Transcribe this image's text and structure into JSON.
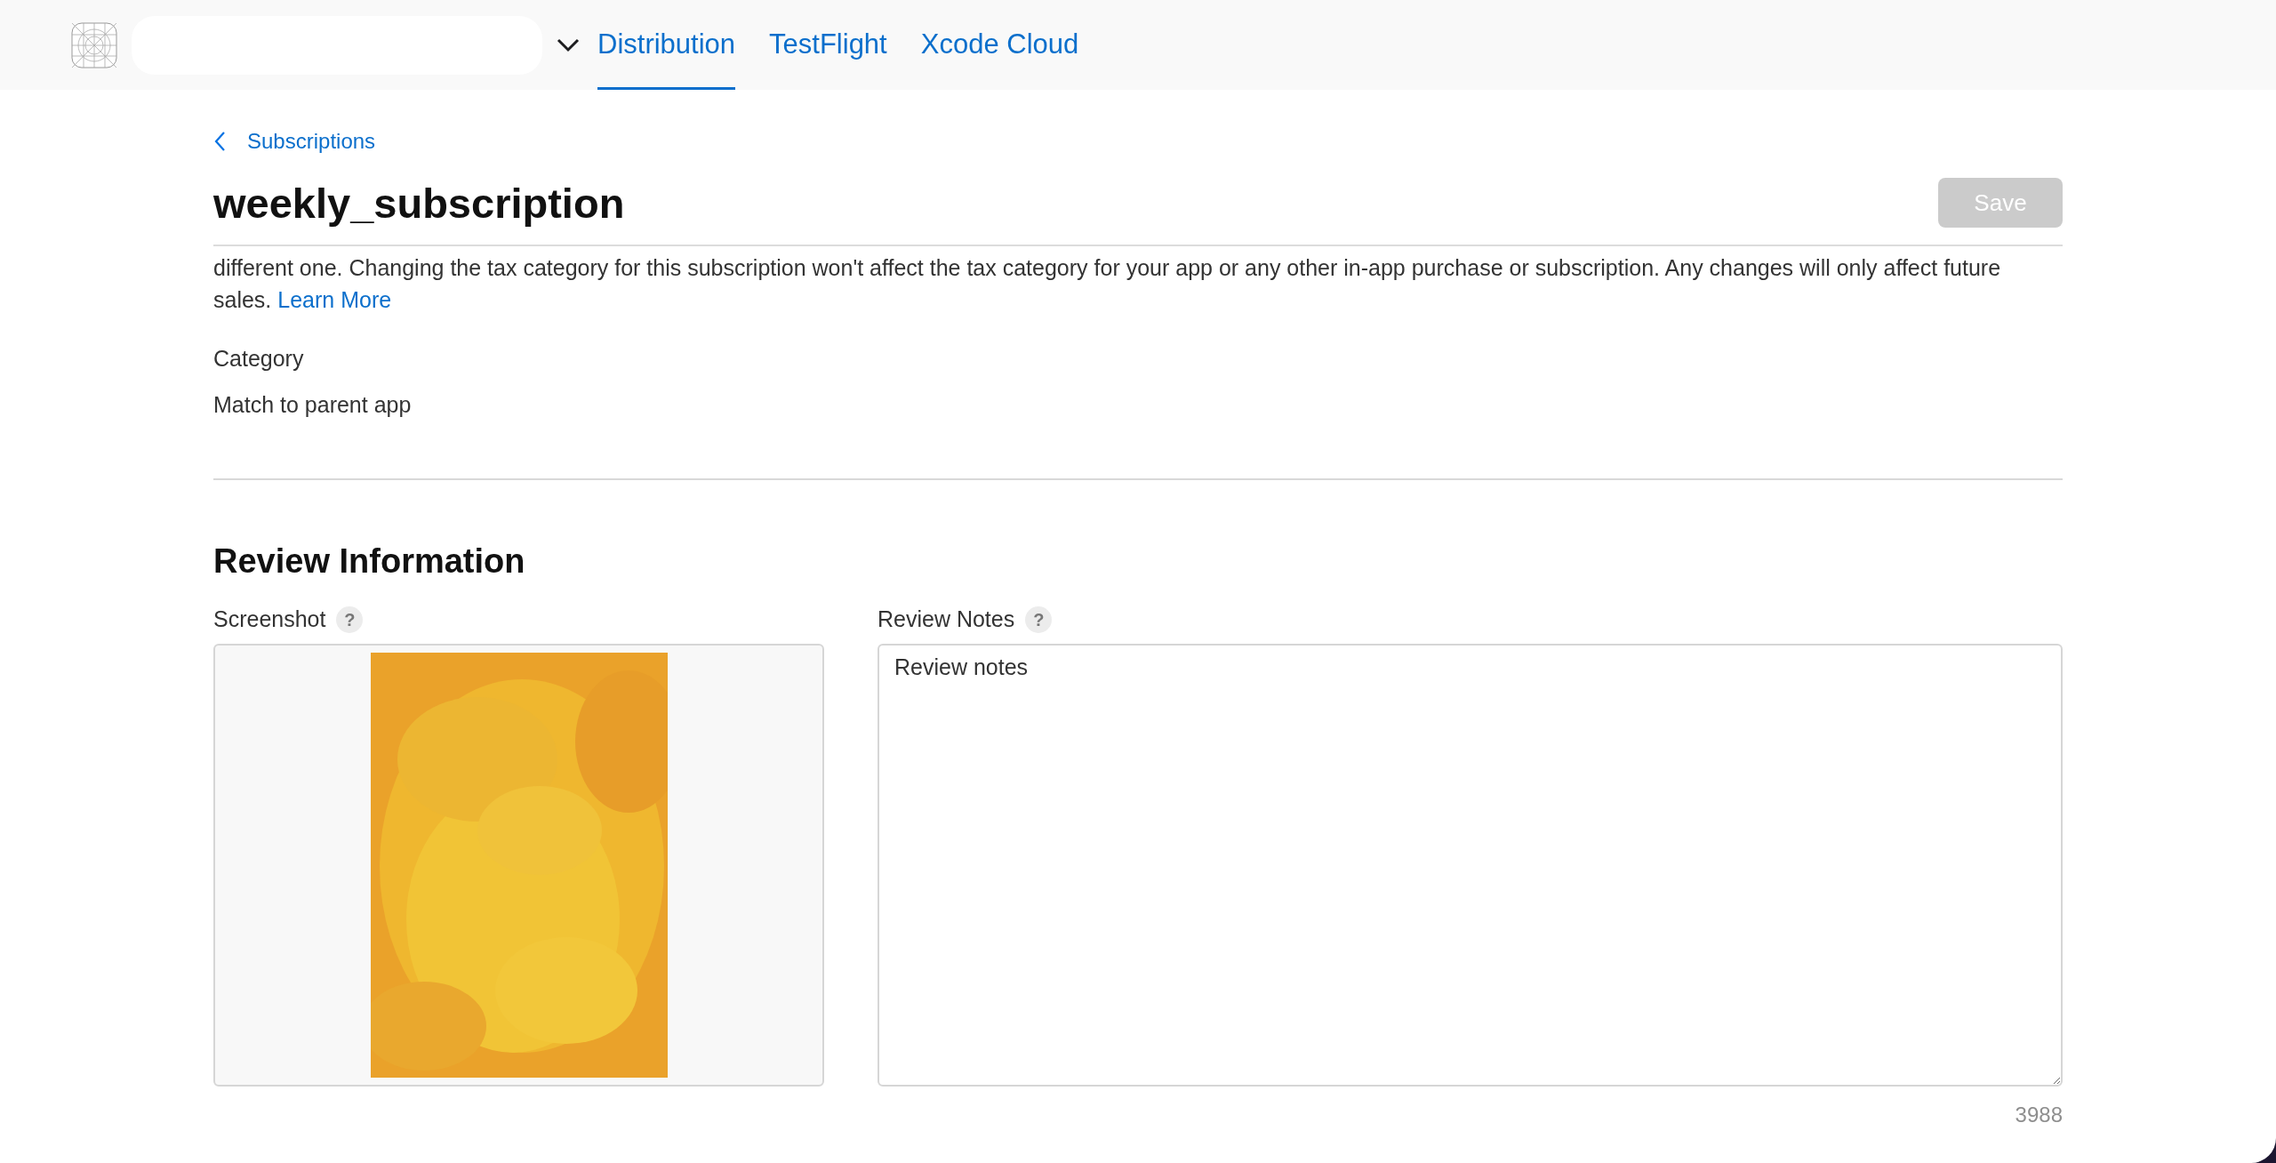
{
  "tabs": [
    {
      "label": "Distribution",
      "selected": true
    },
    {
      "label": "TestFlight",
      "selected": false
    },
    {
      "label": "Xcode Cloud",
      "selected": false
    }
  ],
  "breadcrumb": {
    "label": "Subscriptions"
  },
  "title": "weekly_subscription",
  "save_button": {
    "label": "Save",
    "disabled": true
  },
  "tax_note": {
    "text": "different one. Changing the tax category for this subscription won't affect the tax category for your app or any other in-app purchase or subscription. Any changes will only affect future sales.",
    "link": "Learn More"
  },
  "category": {
    "label": "Category",
    "value": "Match to parent app"
  },
  "review_information": {
    "heading": "Review Information",
    "screenshot": {
      "label": "Screenshot",
      "help": "?"
    },
    "review_notes": {
      "label": "Review Notes",
      "help": "?",
      "value": "Review notes",
      "remaining": "3988"
    }
  }
}
